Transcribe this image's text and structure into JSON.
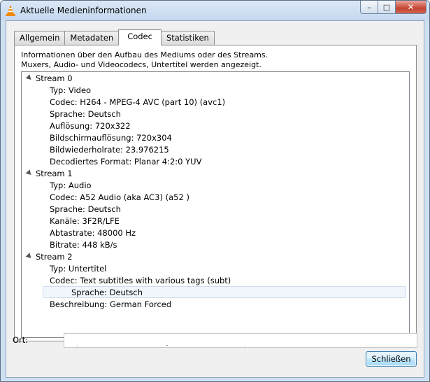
{
  "window": {
    "title": "Aktuelle Medieninformationen",
    "caption_buttons": {
      "minimize": "–",
      "maximize": "□",
      "close": "✕"
    }
  },
  "tabs": [
    {
      "label": "Allgemein",
      "active": false
    },
    {
      "label": "Metadaten",
      "active": false
    },
    {
      "label": "Codec",
      "active": true
    },
    {
      "label": "Statistiken",
      "active": false
    }
  ],
  "codec": {
    "info_line1": "Informationen über den Aufbau des Mediums oder des Streams.",
    "info_line2": "Muxers, Audio- und Videocodecs, Untertitel werden angezeigt.",
    "streams": [
      {
        "name": "Stream 0",
        "expanded": true,
        "items": [
          "Typ: Video",
          "Codec: H264 - MPEG-4 AVC (part 10) (avc1)",
          "Sprache: Deutsch",
          "Auflösung: 720x322",
          "Bildschirmauflösung: 720x304",
          "Bildwiederholrate: 23.976215",
          "Decodiertes Format: Planar 4:2:0 YUV"
        ]
      },
      {
        "name": "Stream 1",
        "expanded": true,
        "items": [
          "Typ: Audio",
          "Codec: A52 Audio (aka AC3) (a52 )",
          "Sprache: Deutsch",
          "Kanäle: 3F2R/LFE",
          "Abtastrate: 48000 Hz",
          "Bitrate: 448 kB/s"
        ]
      },
      {
        "name": "Stream 2",
        "expanded": true,
        "items": [
          "Typ: Untertitel",
          "Codec: Text subtitles with various tags (subt)",
          "Sprache: Deutsch",
          "Beschreibung: German Forced"
        ]
      }
    ],
    "selected_item": "Sprache: Deutsch"
  },
  "location": {
    "label": "Ort:",
    "value": ""
  },
  "buttons": {
    "close_label": "Schließen"
  },
  "icons": {
    "app": "vlc-cone-icon",
    "expander": "expanded-triangle-icon"
  }
}
